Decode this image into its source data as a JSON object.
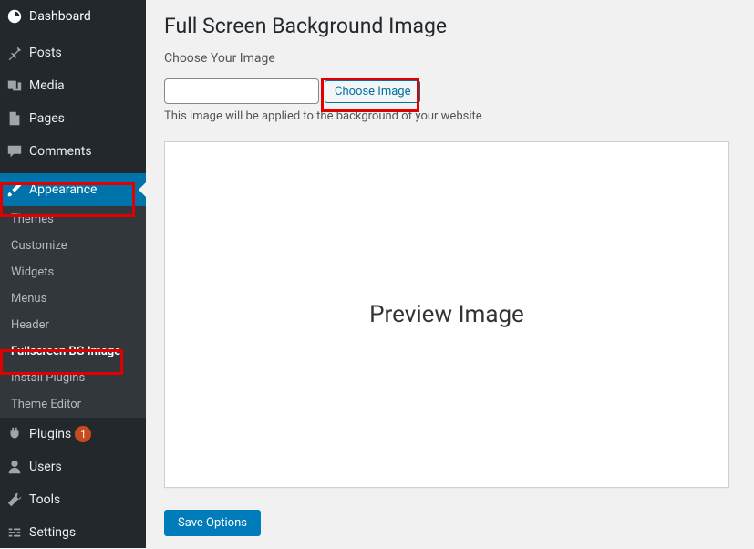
{
  "sidebar": {
    "dashboard": "Dashboard",
    "posts": "Posts",
    "media": "Media",
    "pages": "Pages",
    "comments": "Comments",
    "appearance": "Appearance",
    "appearance_sub": {
      "themes": "Themes",
      "customize": "Customize",
      "widgets": "Widgets",
      "menus": "Menus",
      "header": "Header",
      "fullscreen_bg": "Fullscreen BG Image",
      "install_plugins": "Install Plugins",
      "theme_editor": "Theme Editor"
    },
    "plugins": "Plugins",
    "plugins_badge": "1",
    "users": "Users",
    "tools": "Tools",
    "settings": "Settings"
  },
  "page": {
    "title": "Full Screen Background Image",
    "section_label": "Choose Your Image",
    "path_value": "",
    "choose_btn": "Choose Image",
    "help": "This image will be applied to the background of your website",
    "preview_placeholder": "Preview Image",
    "save_btn": "Save Options"
  }
}
